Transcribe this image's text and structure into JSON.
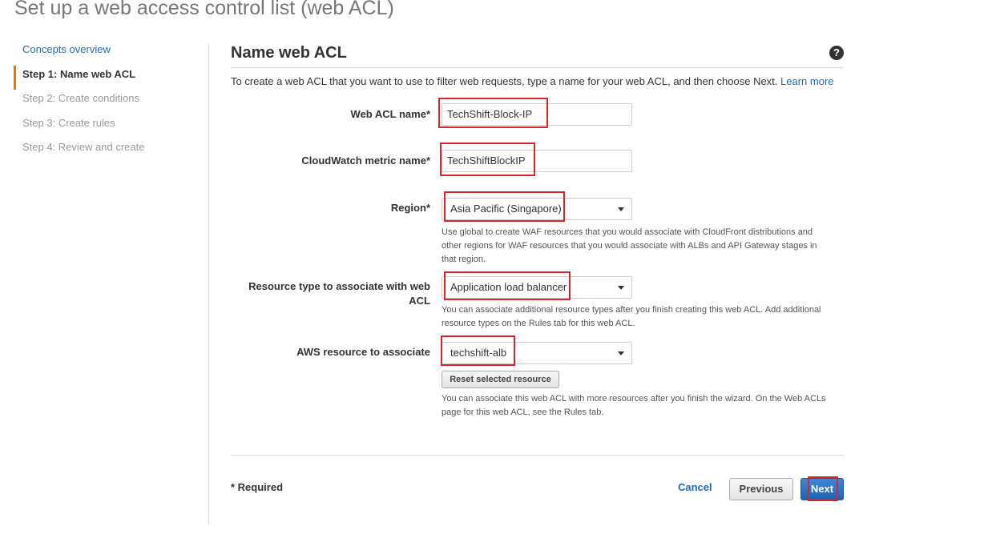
{
  "page_title": "Set up a web access control list (web ACL)",
  "sidebar": {
    "items": [
      {
        "label": "Concepts overview"
      },
      {
        "label": "Step 1: Name web ACL"
      },
      {
        "label": "Step 2: Create conditions"
      },
      {
        "label": "Step 3: Create rules"
      },
      {
        "label": "Step 4: Review and create"
      }
    ]
  },
  "main": {
    "title": "Name web ACL",
    "help_icon": "?",
    "intro_text": "To create a web ACL that you want to use to filter web requests, type a name for your web ACL, and then choose Next.",
    "learn_more": "Learn more"
  },
  "form": {
    "web_acl_name": {
      "label": "Web ACL name",
      "required_mark": "*",
      "value": "TechShift-Block-IP"
    },
    "cloudwatch_metric": {
      "label": "CloudWatch metric name",
      "required_mark": "*",
      "value": "TechShiftBlockIP"
    },
    "region": {
      "label": "Region",
      "required_mark": "*",
      "value": "Asia Pacific (Singapore)",
      "hint": "Use global to create WAF resources that you would associate with CloudFront distributions and other regions for WAF resources that you would associate with ALBs and API Gateway stages in that region."
    },
    "resource_type": {
      "label": "Resource type to associate with web ACL",
      "value": "Application load balancer",
      "hint": "You can associate additional resource types after you finish creating this web ACL. Add additional resource types on the Rules tab for this web ACL."
    },
    "aws_resource": {
      "label": "AWS resource to associate",
      "value": "techshift-alb",
      "reset_button": "Reset selected resource",
      "hint": "You can associate this web ACL with more resources after you finish the wizard. On the Web ACLs page for this web ACL, see the Rules tab."
    }
  },
  "footer": {
    "required_note": "* Required",
    "cancel": "Cancel",
    "previous": "Previous",
    "next": "Next"
  },
  "colors": {
    "accent": "#e07b00",
    "link": "#1e6cb5",
    "highlight": "#d9262c",
    "primary_button": "#1c64b8"
  }
}
